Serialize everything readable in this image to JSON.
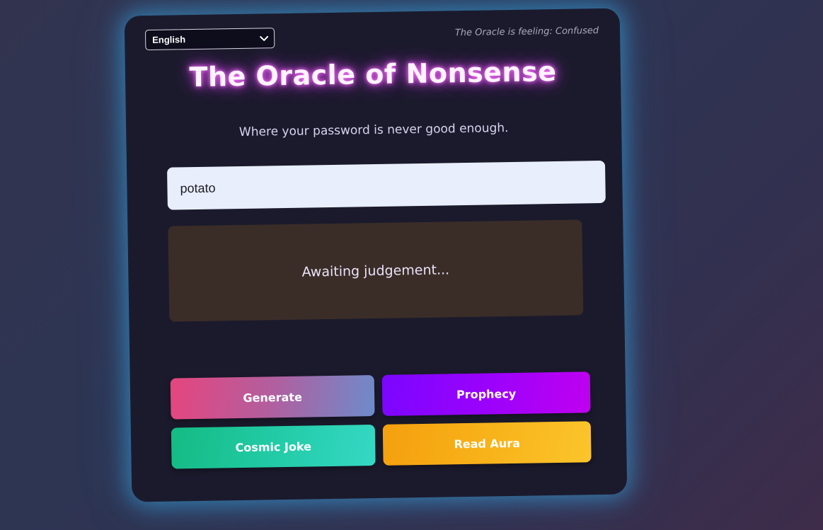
{
  "language_select": {
    "value": "English"
  },
  "mood": {
    "text": "The Oracle is feeling: Confused"
  },
  "header": {
    "title": "The Oracle of Nonsense",
    "subtitle": "Where your password is never good enough."
  },
  "password_input": {
    "value": "potato"
  },
  "verdict": {
    "text": "Awaiting judgement..."
  },
  "buttons": {
    "generate": "Generate",
    "prophecy": "Prophecy",
    "cosmic_joke": "Cosmic Joke",
    "read_aura": "Read Aura"
  },
  "colors": {
    "card_glow": "#35aae6",
    "title_glow": "#e24cf0",
    "card_bg": "#1b1a2c",
    "verdict_bg": "#3a2d28"
  },
  "icons": {
    "select_arrow": "chevron-down-icon"
  }
}
